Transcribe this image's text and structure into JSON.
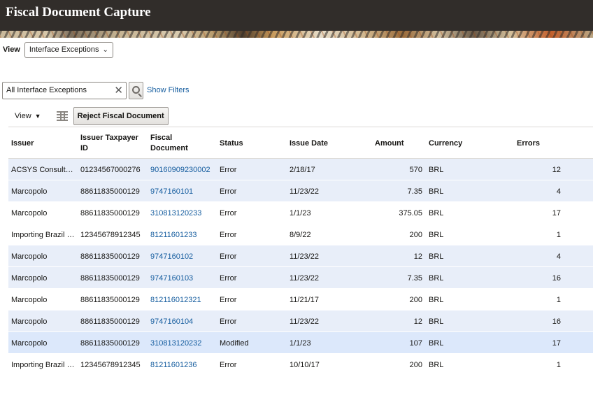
{
  "app": {
    "title": "Fiscal Document Capture"
  },
  "view": {
    "label": "View",
    "selected": "Interface Exceptions"
  },
  "search": {
    "value": "All Interface Exceptions",
    "show_filters": "Show Filters"
  },
  "toolbar": {
    "view_menu": "View",
    "reject_button": "Reject Fiscal Document"
  },
  "table": {
    "columns": [
      "Issuer",
      "Issuer Taxpayer ID",
      "Fiscal Document",
      "Status",
      "Issue Date",
      "Amount",
      "Currency",
      "Errors"
    ],
    "rows": [
      [
        "ACSYS Consult…",
        "01234567000276",
        "90160909230002",
        "Error",
        "2/18/17",
        "570",
        "BRL",
        "12"
      ],
      [
        "Marcopolo",
        "88611835000129",
        "9747160101",
        "Error",
        "11/23/22",
        "7.35",
        "BRL",
        "4"
      ],
      [
        "Marcopolo",
        "88611835000129",
        "310813120233",
        "Error",
        "1/1/23",
        "375.05",
        "BRL",
        "17"
      ],
      [
        "Importing Brazil …",
        "12345678912345",
        "81211601233",
        "Error",
        "8/9/22",
        "200",
        "BRL",
        "1"
      ],
      [
        "Marcopolo",
        "88611835000129",
        "9747160102",
        "Error",
        "11/23/22",
        "12",
        "BRL",
        "4"
      ],
      [
        "Marcopolo",
        "88611835000129",
        "9747160103",
        "Error",
        "11/23/22",
        "7.35",
        "BRL",
        "16"
      ],
      [
        "Marcopolo",
        "88611835000129",
        "812116012321",
        "Error",
        "11/21/17",
        "200",
        "BRL",
        "1"
      ],
      [
        "Marcopolo",
        "88611835000129",
        "9747160104",
        "Error",
        "11/23/22",
        "12",
        "BRL",
        "16"
      ],
      [
        "Marcopolo",
        "88611835000129",
        "310813120232",
        "Modified",
        "1/1/23",
        "107",
        "BRL",
        "17"
      ],
      [
        "Importing Brazil …",
        "12345678912345",
        "81211601236",
        "Error",
        "10/10/17",
        "200",
        "BRL",
        "1"
      ]
    ]
  },
  "colors": {
    "header_bg": "#312d2a",
    "link": "#145c9e",
    "row_alt": "#e8eef9"
  },
  "icons": {
    "select": "chevron-down-icon",
    "clear": "close-icon",
    "search": "search-icon",
    "view_menu": "caret-down-icon",
    "columns": "freeze-columns-icon"
  }
}
